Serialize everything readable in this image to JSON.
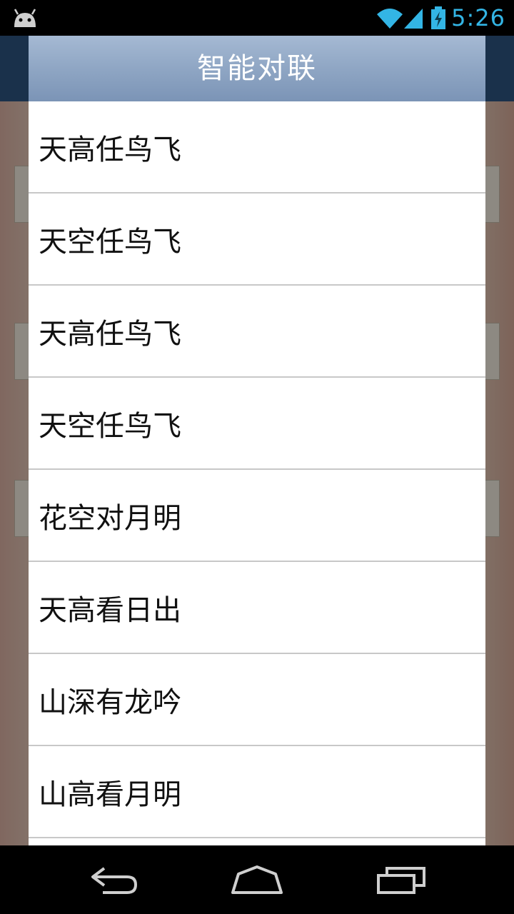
{
  "status_bar": {
    "time": "5:26",
    "icons": [
      "android-icon",
      "wifi-icon",
      "signal-icon",
      "battery-charging-icon"
    ],
    "icon_color": "#33b5e5"
  },
  "dialog": {
    "title": "智能对联",
    "options": [
      {
        "label": "天高任鸟飞"
      },
      {
        "label": "天空任鸟飞"
      },
      {
        "label": "天高任鸟飞"
      },
      {
        "label": "天空任鸟飞"
      },
      {
        "label": "花空对月明"
      },
      {
        "label": "天高看日出"
      },
      {
        "label": "山深有龙吟"
      },
      {
        "label": "山高看月明"
      },
      {
        "label": ""
      }
    ]
  },
  "nav_bar": {
    "icons": [
      "back-icon",
      "home-icon",
      "recents-icon"
    ]
  },
  "colors": {
    "dialog_header": "#8fa6c4",
    "status_accent": "#33b5e5"
  }
}
